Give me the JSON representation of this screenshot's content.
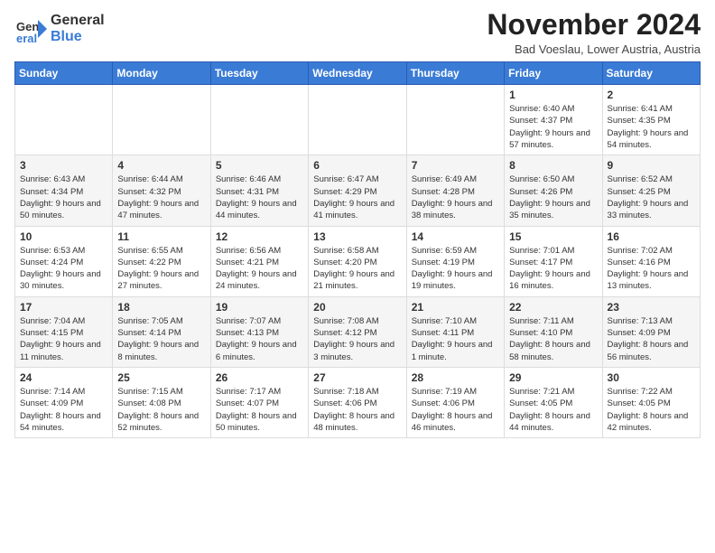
{
  "header": {
    "logo_general": "General",
    "logo_blue": "Blue",
    "month_year": "November 2024",
    "location": "Bad Voeslau, Lower Austria, Austria"
  },
  "weekdays": [
    "Sunday",
    "Monday",
    "Tuesday",
    "Wednesday",
    "Thursday",
    "Friday",
    "Saturday"
  ],
  "weeks": [
    [
      {
        "day": "",
        "info": ""
      },
      {
        "day": "",
        "info": ""
      },
      {
        "day": "",
        "info": ""
      },
      {
        "day": "",
        "info": ""
      },
      {
        "day": "",
        "info": ""
      },
      {
        "day": "1",
        "info": "Sunrise: 6:40 AM\nSunset: 4:37 PM\nDaylight: 9 hours\nand 57 minutes."
      },
      {
        "day": "2",
        "info": "Sunrise: 6:41 AM\nSunset: 4:35 PM\nDaylight: 9 hours\nand 54 minutes."
      }
    ],
    [
      {
        "day": "3",
        "info": "Sunrise: 6:43 AM\nSunset: 4:34 PM\nDaylight: 9 hours\nand 50 minutes."
      },
      {
        "day": "4",
        "info": "Sunrise: 6:44 AM\nSunset: 4:32 PM\nDaylight: 9 hours\nand 47 minutes."
      },
      {
        "day": "5",
        "info": "Sunrise: 6:46 AM\nSunset: 4:31 PM\nDaylight: 9 hours\nand 44 minutes."
      },
      {
        "day": "6",
        "info": "Sunrise: 6:47 AM\nSunset: 4:29 PM\nDaylight: 9 hours\nand 41 minutes."
      },
      {
        "day": "7",
        "info": "Sunrise: 6:49 AM\nSunset: 4:28 PM\nDaylight: 9 hours\nand 38 minutes."
      },
      {
        "day": "8",
        "info": "Sunrise: 6:50 AM\nSunset: 4:26 PM\nDaylight: 9 hours\nand 35 minutes."
      },
      {
        "day": "9",
        "info": "Sunrise: 6:52 AM\nSunset: 4:25 PM\nDaylight: 9 hours\nand 33 minutes."
      }
    ],
    [
      {
        "day": "10",
        "info": "Sunrise: 6:53 AM\nSunset: 4:24 PM\nDaylight: 9 hours\nand 30 minutes."
      },
      {
        "day": "11",
        "info": "Sunrise: 6:55 AM\nSunset: 4:22 PM\nDaylight: 9 hours\nand 27 minutes."
      },
      {
        "day": "12",
        "info": "Sunrise: 6:56 AM\nSunset: 4:21 PM\nDaylight: 9 hours\nand 24 minutes."
      },
      {
        "day": "13",
        "info": "Sunrise: 6:58 AM\nSunset: 4:20 PM\nDaylight: 9 hours\nand 21 minutes."
      },
      {
        "day": "14",
        "info": "Sunrise: 6:59 AM\nSunset: 4:19 PM\nDaylight: 9 hours\nand 19 minutes."
      },
      {
        "day": "15",
        "info": "Sunrise: 7:01 AM\nSunset: 4:17 PM\nDaylight: 9 hours\nand 16 minutes."
      },
      {
        "day": "16",
        "info": "Sunrise: 7:02 AM\nSunset: 4:16 PM\nDaylight: 9 hours\nand 13 minutes."
      }
    ],
    [
      {
        "day": "17",
        "info": "Sunrise: 7:04 AM\nSunset: 4:15 PM\nDaylight: 9 hours\nand 11 minutes."
      },
      {
        "day": "18",
        "info": "Sunrise: 7:05 AM\nSunset: 4:14 PM\nDaylight: 9 hours\nand 8 minutes."
      },
      {
        "day": "19",
        "info": "Sunrise: 7:07 AM\nSunset: 4:13 PM\nDaylight: 9 hours\nand 6 minutes."
      },
      {
        "day": "20",
        "info": "Sunrise: 7:08 AM\nSunset: 4:12 PM\nDaylight: 9 hours\nand 3 minutes."
      },
      {
        "day": "21",
        "info": "Sunrise: 7:10 AM\nSunset: 4:11 PM\nDaylight: 9 hours\nand 1 minute."
      },
      {
        "day": "22",
        "info": "Sunrise: 7:11 AM\nSunset: 4:10 PM\nDaylight: 8 hours\nand 58 minutes."
      },
      {
        "day": "23",
        "info": "Sunrise: 7:13 AM\nSunset: 4:09 PM\nDaylight: 8 hours\nand 56 minutes."
      }
    ],
    [
      {
        "day": "24",
        "info": "Sunrise: 7:14 AM\nSunset: 4:09 PM\nDaylight: 8 hours\nand 54 minutes."
      },
      {
        "day": "25",
        "info": "Sunrise: 7:15 AM\nSunset: 4:08 PM\nDaylight: 8 hours\nand 52 minutes."
      },
      {
        "day": "26",
        "info": "Sunrise: 7:17 AM\nSunset: 4:07 PM\nDaylight: 8 hours\nand 50 minutes."
      },
      {
        "day": "27",
        "info": "Sunrise: 7:18 AM\nSunset: 4:06 PM\nDaylight: 8 hours\nand 48 minutes."
      },
      {
        "day": "28",
        "info": "Sunrise: 7:19 AM\nSunset: 4:06 PM\nDaylight: 8 hours\nand 46 minutes."
      },
      {
        "day": "29",
        "info": "Sunrise: 7:21 AM\nSunset: 4:05 PM\nDaylight: 8 hours\nand 44 minutes."
      },
      {
        "day": "30",
        "info": "Sunrise: 7:22 AM\nSunset: 4:05 PM\nDaylight: 8 hours\nand 42 minutes."
      }
    ]
  ]
}
